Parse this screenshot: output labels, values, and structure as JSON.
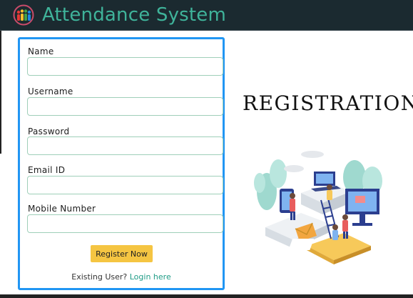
{
  "header": {
    "title": "Attendance System",
    "logo_icon": "people-group-logo-icon",
    "background": "#1b2a30",
    "title_color": "#3fb39a"
  },
  "form": {
    "fields": [
      {
        "label": "Name",
        "value": ""
      },
      {
        "label": "Username",
        "value": ""
      },
      {
        "label": "Password",
        "value": ""
      },
      {
        "label": "Email ID",
        "value": ""
      },
      {
        "label": "Mobile Number",
        "value": ""
      }
    ],
    "register_button": "Register Now",
    "existing_user_text": "Existing User?",
    "login_link": "Login here",
    "border_color": "#2196f3",
    "button_color": "#f5c542",
    "link_color": "#1f9c86"
  },
  "side": {
    "heading": "REGISTRATION",
    "illustration_icon": "people-with-devices-illustration"
  }
}
